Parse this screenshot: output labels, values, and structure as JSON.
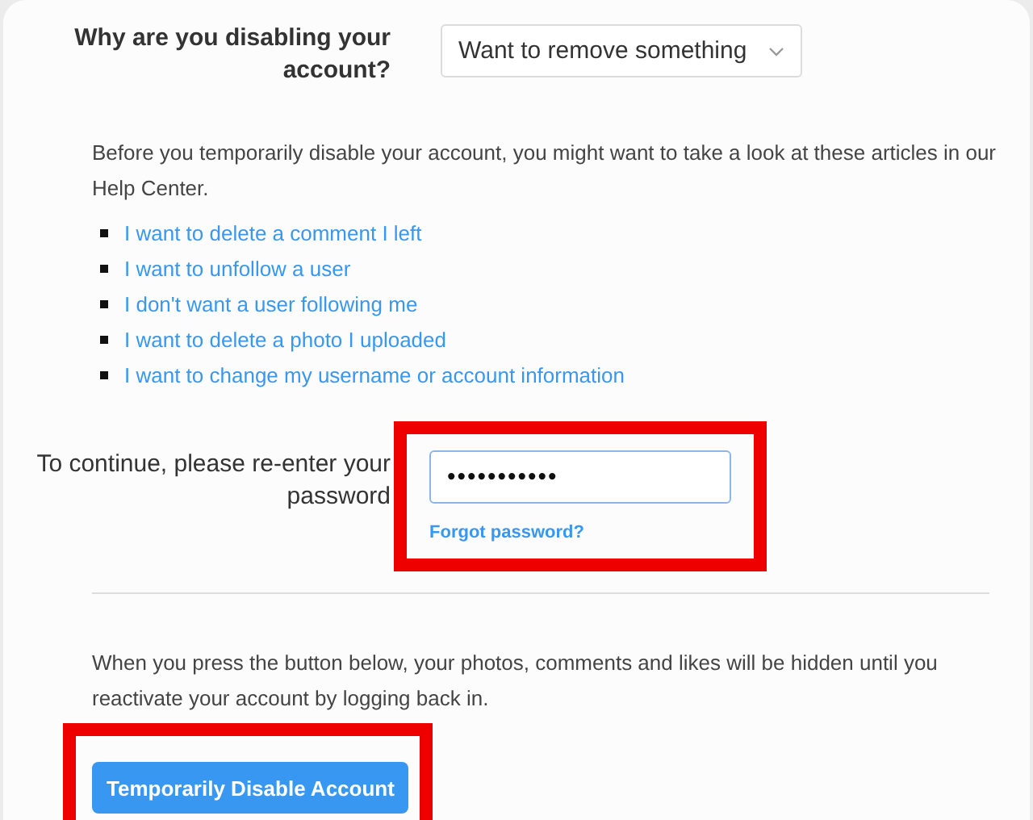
{
  "reason": {
    "label": "Why are you disabling your account?",
    "value": "Want to remove something"
  },
  "intro": "Before you temporarily disable your account, you might want to take a look at these articles in our Help Center.",
  "articles": [
    "I want to delete a comment I left",
    "I want to unfollow a user",
    "I don't want a user following me",
    "I want to delete a photo I uploaded",
    "I want to change my username or account information"
  ],
  "password": {
    "label": "To continue, please re-enter your password",
    "value": "•••••••••••",
    "focused": true,
    "highlighted": true,
    "forgot_link": "Forgot password?"
  },
  "notice": "When you press the button below, your photos, comments and likes will be hidden until you reactivate your account by logging back in.",
  "disable_button": {
    "label": "Temporarily Disable Account",
    "highlighted": true
  }
}
